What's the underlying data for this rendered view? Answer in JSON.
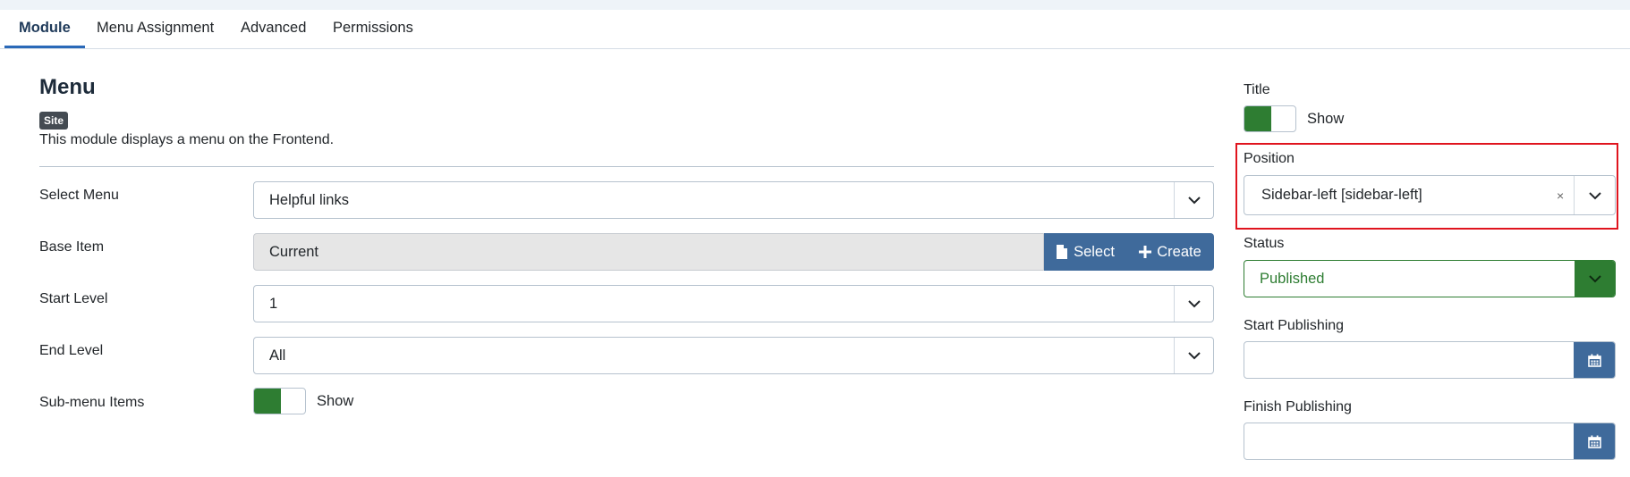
{
  "tabs": [
    {
      "label": "Module"
    },
    {
      "label": "Menu Assignment"
    },
    {
      "label": "Advanced"
    },
    {
      "label": "Permissions"
    }
  ],
  "module": {
    "title": "Menu",
    "badge": "Site",
    "description": "This module displays a menu on the Frontend."
  },
  "fields": {
    "select_menu": {
      "label": "Select Menu",
      "value": "Helpful links"
    },
    "base_item": {
      "label": "Base Item",
      "value": "Current",
      "select_label": "Select",
      "create_label": "Create"
    },
    "start_level": {
      "label": "Start Level",
      "value": "1"
    },
    "end_level": {
      "label": "End Level",
      "value": "All"
    },
    "submenu_items": {
      "label": "Sub-menu Items",
      "toggle_text": "Show"
    }
  },
  "sidebar": {
    "title": {
      "label": "Title",
      "toggle_text": "Show"
    },
    "position": {
      "label": "Position",
      "value": "Sidebar-left [sidebar-left]",
      "clear": "×"
    },
    "status": {
      "label": "Status",
      "value": "Published"
    },
    "start_publishing": {
      "label": "Start Publishing",
      "value": ""
    },
    "finish_publishing": {
      "label": "Finish Publishing",
      "value": ""
    }
  },
  "colors": {
    "accent": "#2a69b8",
    "button_blue": "#3f6a9b",
    "toggle_green": "#2e7d32",
    "highlight_red": "#e0141e"
  },
  "icons": [
    "chevron-down-icon",
    "file-icon",
    "plus-icon",
    "calendar-icon",
    "close-icon"
  ]
}
